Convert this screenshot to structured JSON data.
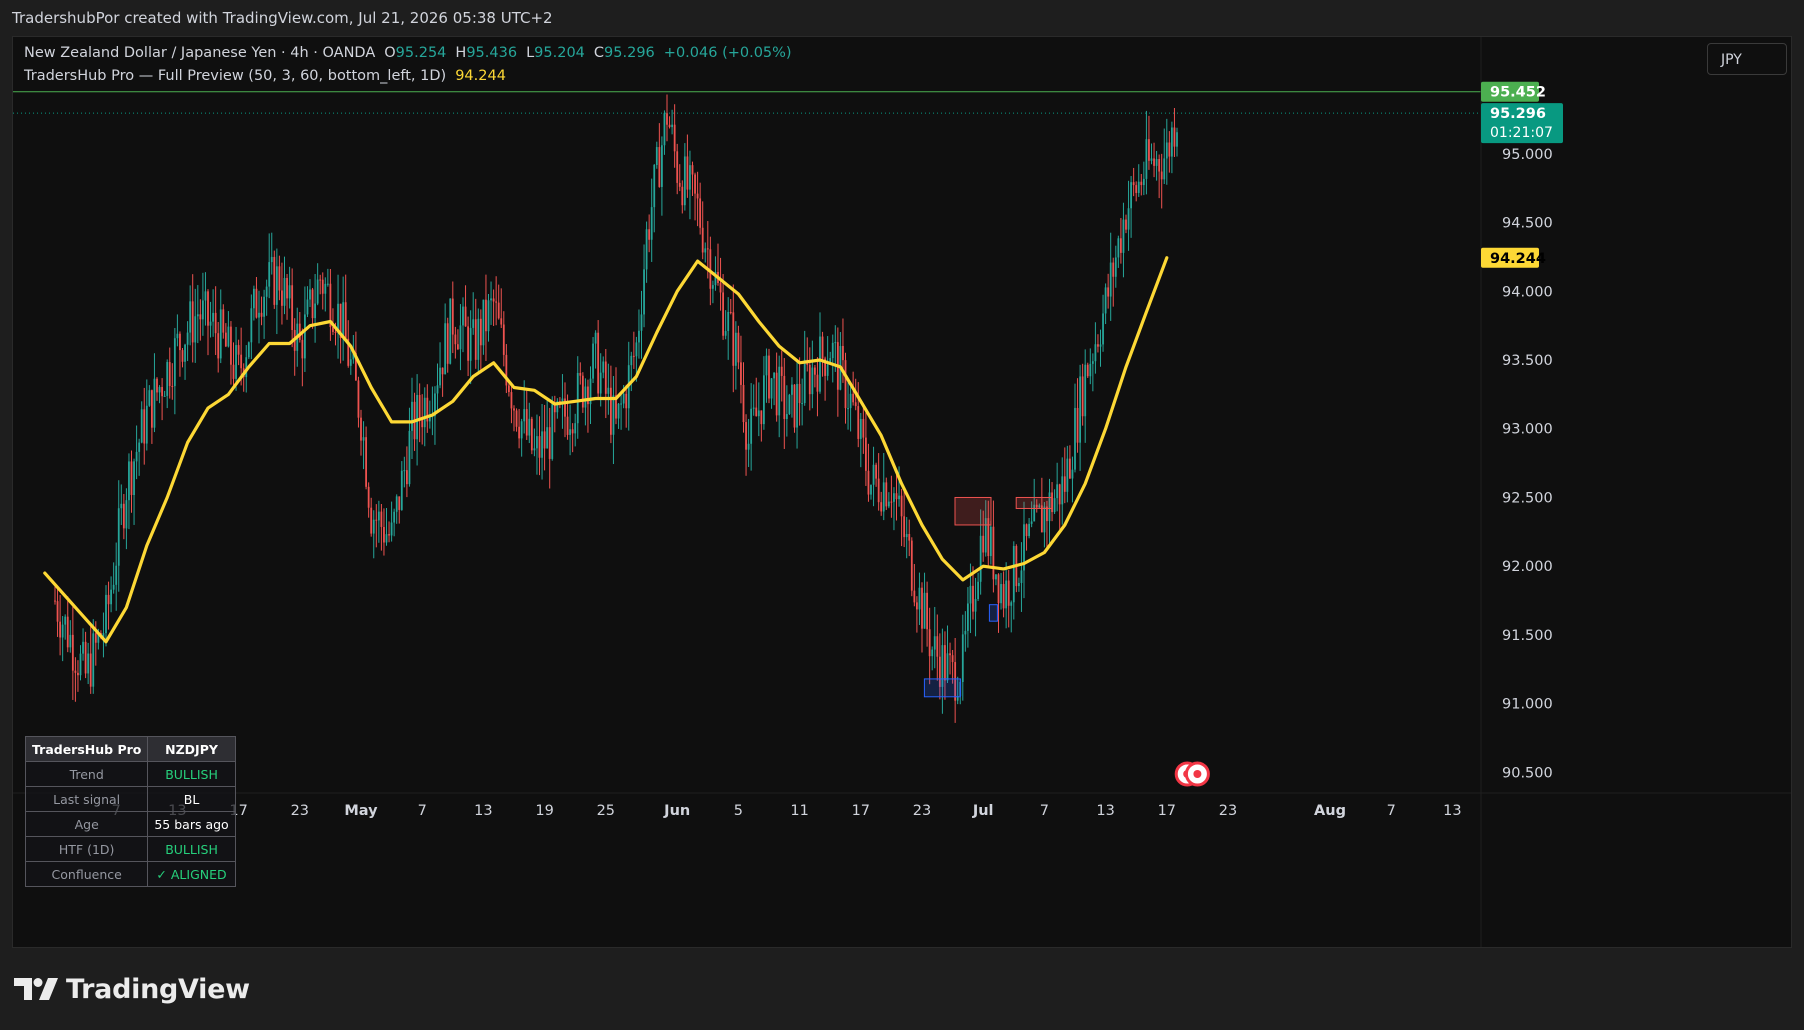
{
  "header": {
    "caption": "TradershubPor created with TradingView.com, Jul 21, 2026 05:38 UTC+2"
  },
  "legend": {
    "symbol": "New Zealand Dollar / Japanese Yen · 4h · OANDA",
    "o_label": "O",
    "o_value": "95.254",
    "h_label": "H",
    "h_value": "95.436",
    "l_label": "L",
    "l_value": "95.204",
    "c_label": "C",
    "c_value": "95.296",
    "change": "+0.046 (+0.05%)",
    "indicator": "TradersHub Pro — Full Preview (50, 3, 60, bottom_left, 1D)",
    "indicator_value": "94.244"
  },
  "currency_button": "JPY",
  "info_table": {
    "header_left": "TradersHub Pro",
    "header_right": "NZDJPY",
    "rows": [
      {
        "label": "Trend",
        "value": "BULLISH",
        "tone": "green"
      },
      {
        "label": "Last signal",
        "value": "BL",
        "tone": "white"
      },
      {
        "label": "Age",
        "value": "55 bars ago",
        "tone": "white"
      },
      {
        "label": "HTF (1D)",
        "value": "BULLISH",
        "tone": "green"
      },
      {
        "label": "Confluence",
        "value": "✓ ALIGNED",
        "tone": "green"
      }
    ]
  },
  "logo": {
    "text": "TradingView",
    "icon": "tradingview-logo-icon"
  },
  "colors": {
    "background": "#0f0f0f",
    "up": "#26a69a",
    "down": "#ef5350",
    "ma": "#fdd835",
    "high_line": "#4caf50",
    "price_tag": "#089981",
    "ma_tag": "#fdd835",
    "grid": "none"
  },
  "chart_data": {
    "type": "candlestick",
    "timeframe": "4h",
    "x_ticks": [
      "7",
      "13",
      "17",
      "23",
      "May",
      "7",
      "13",
      "19",
      "25",
      "Jun",
      "5",
      "11",
      "17",
      "23",
      "Jul",
      "7",
      "13",
      "17",
      "23",
      "Aug",
      "7",
      "13"
    ],
    "y_ticks": [
      "95.000",
      "94.500",
      "94.000",
      "93.500",
      "93.000",
      "92.500",
      "92.000",
      "91.500",
      "91.000",
      "90.500"
    ],
    "ylim": [
      90.35,
      95.85
    ],
    "grid": false,
    "price_labels": {
      "high_line": "95.452",
      "last_price": "95.296",
      "countdown": "01:21:07",
      "ma_value": "94.244"
    },
    "close_path": [
      [
        "Apr 1",
        91.75
      ],
      [
        "Apr 4",
        91.2
      ],
      [
        "Apr 6",
        91.6
      ],
      [
        "Apr 8",
        92.6
      ],
      [
        "Apr 10",
        93.1
      ],
      [
        "Apr 13",
        93.6
      ],
      [
        "Apr 15",
        93.85
      ],
      [
        "Apr 17",
        93.7
      ],
      [
        "Apr 19",
        93.4
      ],
      [
        "Apr 21",
        94.0
      ],
      [
        "Apr 23",
        94.1
      ],
      [
        "Apr 25",
        93.6
      ],
      [
        "Apr 27",
        94.1
      ],
      [
        "Apr 29",
        93.8
      ],
      [
        "May 1",
        93.1
      ],
      [
        "May 2",
        92.4
      ],
      [
        "May 4",
        92.2
      ],
      [
        "May 6",
        93.0
      ],
      [
        "May 8",
        93.3
      ],
      [
        "May 10",
        93.8
      ],
      [
        "May 12",
        93.6
      ],
      [
        "May 14",
        93.9
      ],
      [
        "May 16",
        93.2
      ],
      [
        "May 18",
        92.8
      ],
      [
        "May 20",
        93.0
      ],
      [
        "May 22",
        93.2
      ],
      [
        "May 24",
        93.5
      ],
      [
        "May 26",
        93.0
      ],
      [
        "May 28",
        93.6
      ],
      [
        "May 29",
        94.4
      ],
      [
        "May 31",
        95.3
      ],
      [
        "Jun 1",
        94.9
      ],
      [
        "Jun 3",
        94.6
      ],
      [
        "Jun 5",
        94.0
      ],
      [
        "Jun 7",
        93.5
      ],
      [
        "Jun 8",
        92.9
      ],
      [
        "Jun 10",
        93.4
      ],
      [
        "Jun 12",
        93.1
      ],
      [
        "Jun 14",
        93.4
      ],
      [
        "Jun 16",
        93.6
      ],
      [
        "Jun 18",
        93.2
      ],
      [
        "Jun 20",
        92.6
      ],
      [
        "Jun 22",
        92.6
      ],
      [
        "Jun 24",
        92.0
      ],
      [
        "Jun 26",
        91.4
      ],
      [
        "Jun 28",
        91.2
      ],
      [
        "Jun 29",
        91.3
      ],
      [
        "Jul 1",
        92.3
      ],
      [
        "Jul 3",
        91.8
      ],
      [
        "Jul 5",
        92.1
      ],
      [
        "Jul 7",
        92.4
      ],
      [
        "Jul 9",
        92.6
      ],
      [
        "Jul 11",
        93.4
      ],
      [
        "Jul 13",
        93.9
      ],
      [
        "Jul 15",
        94.6
      ],
      [
        "Jul 17",
        94.9
      ],
      [
        "Jul 19",
        95.0
      ],
      [
        "Jul 20",
        95.3
      ]
    ],
    "ma_path": [
      [
        "Mar 31",
        91.95
      ],
      [
        "Apr 3",
        91.7
      ],
      [
        "Apr 6",
        91.45
      ],
      [
        "Apr 8",
        91.7
      ],
      [
        "Apr 10",
        92.15
      ],
      [
        "Apr 12",
        92.5
      ],
      [
        "Apr 14",
        92.9
      ],
      [
        "Apr 16",
        93.15
      ],
      [
        "Apr 18",
        93.25
      ],
      [
        "Apr 20",
        93.45
      ],
      [
        "Apr 22",
        93.62
      ],
      [
        "Apr 24",
        93.62
      ],
      [
        "Apr 26",
        93.75
      ],
      [
        "Apr 28",
        93.78
      ],
      [
        "Apr 30",
        93.6
      ],
      [
        "May 2",
        93.3
      ],
      [
        "May 4",
        93.05
      ],
      [
        "May 6",
        93.05
      ],
      [
        "May 8",
        93.1
      ],
      [
        "May 10",
        93.2
      ],
      [
        "May 12",
        93.38
      ],
      [
        "May 14",
        93.48
      ],
      [
        "May 16",
        93.3
      ],
      [
        "May 18",
        93.28
      ],
      [
        "May 20",
        93.18
      ],
      [
        "May 22",
        93.2
      ],
      [
        "May 24",
        93.22
      ],
      [
        "May 26",
        93.22
      ],
      [
        "May 28",
        93.38
      ],
      [
        "May 30",
        93.7
      ],
      [
        "Jun 1",
        94.0
      ],
      [
        "Jun 3",
        94.22
      ],
      [
        "Jun 5",
        94.1
      ],
      [
        "Jun 7",
        93.98
      ],
      [
        "Jun 9",
        93.78
      ],
      [
        "Jun 11",
        93.6
      ],
      [
        "Jun 13",
        93.48
      ],
      [
        "Jun 15",
        93.5
      ],
      [
        "Jun 17",
        93.45
      ],
      [
        "Jun 19",
        93.2
      ],
      [
        "Jun 21",
        92.95
      ],
      [
        "Jun 23",
        92.6
      ],
      [
        "Jun 25",
        92.3
      ],
      [
        "Jun 27",
        92.05
      ],
      [
        "Jun 29",
        91.9
      ],
      [
        "Jul 1",
        92.0
      ],
      [
        "Jul 3",
        91.98
      ],
      [
        "Jul 5",
        92.02
      ],
      [
        "Jul 7",
        92.1
      ],
      [
        "Jul 9",
        92.3
      ],
      [
        "Jul 11",
        92.6
      ],
      [
        "Jul 13",
        93.0
      ],
      [
        "Jul 15",
        93.45
      ],
      [
        "Jul 17",
        93.85
      ],
      [
        "Jul 19",
        94.244
      ]
    ],
    "zones": [
      {
        "date": "Jun 27",
        "low": 91.05,
        "high": 91.18,
        "kind": "demand"
      },
      {
        "date": "Jun 30",
        "low": 92.3,
        "high": 92.5,
        "kind": "supply"
      },
      {
        "date": "Jul 2",
        "low": 91.6,
        "high": 91.72,
        "kind": "demand"
      },
      {
        "date": "Jul 6",
        "low": 92.42,
        "high": 92.5,
        "kind": "supply"
      }
    ],
    "events": [
      {
        "date": "Jul 21"
      },
      {
        "date": "Jul 22"
      }
    ]
  }
}
